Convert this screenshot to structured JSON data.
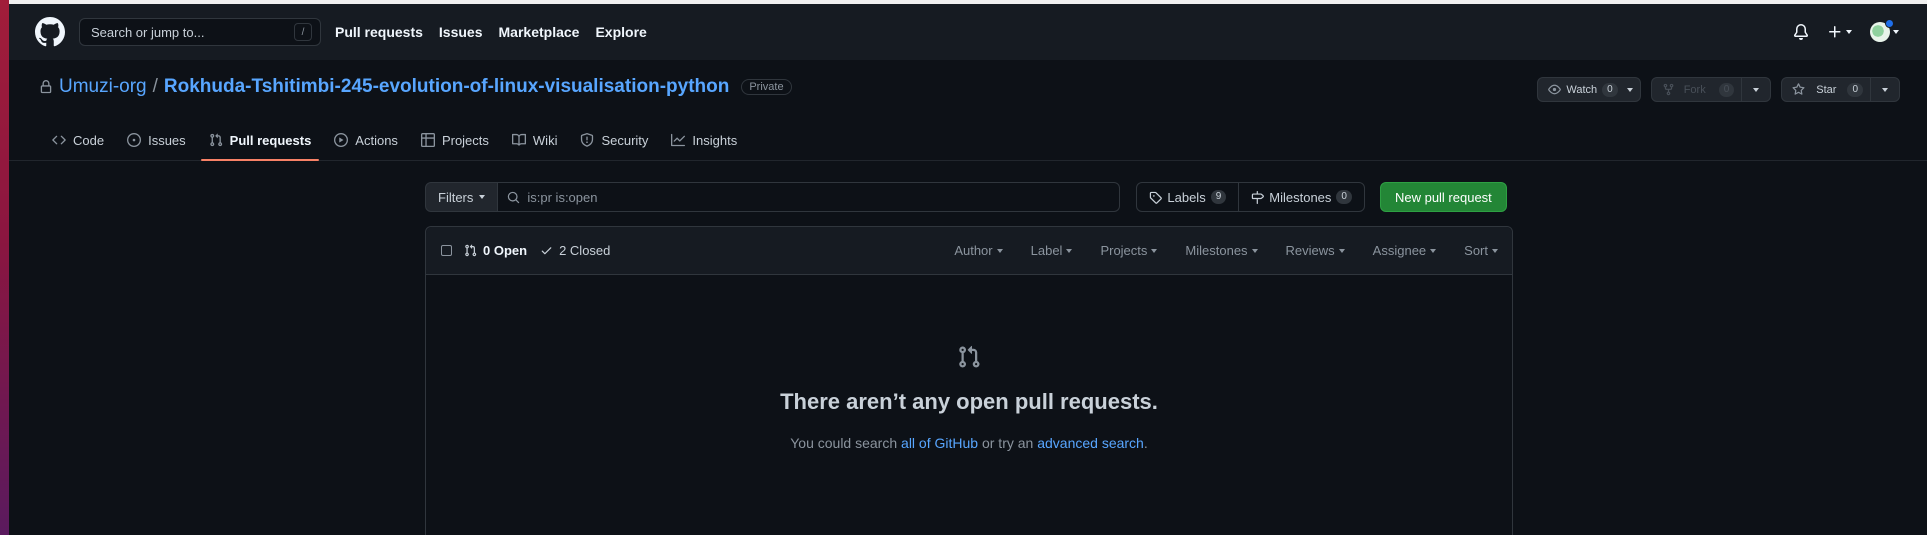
{
  "header": {
    "search_placeholder": "Search or jump to...",
    "search_key": "/",
    "nav": [
      "Pull requests",
      "Issues",
      "Marketplace",
      "Explore"
    ]
  },
  "repo": {
    "owner": "Umuzi-org",
    "separator": "/",
    "name": "Rokhuda-Tshitimbi-245-evolution-of-linux-visualisation-python",
    "visibility": "Private",
    "watch": {
      "label": "Watch",
      "count": "0"
    },
    "fork": {
      "label": "Fork",
      "count": "0"
    },
    "star": {
      "label": "Star",
      "count": "0"
    }
  },
  "tabs": [
    {
      "label": "Code",
      "icon": "code-icon"
    },
    {
      "label": "Issues",
      "icon": "issue-opened-icon"
    },
    {
      "label": "Pull requests",
      "icon": "git-pull-request-icon",
      "active": true
    },
    {
      "label": "Actions",
      "icon": "play-icon"
    },
    {
      "label": "Projects",
      "icon": "table-icon"
    },
    {
      "label": "Wiki",
      "icon": "book-icon"
    },
    {
      "label": "Security",
      "icon": "shield-icon"
    },
    {
      "label": "Insights",
      "icon": "graph-icon"
    }
  ],
  "subnav": {
    "filters_label": "Filters",
    "query": "is:pr is:open",
    "labels_label": "Labels",
    "labels_count": "9",
    "milestones_label": "Milestones",
    "milestones_count": "0",
    "new_pr_label": "New pull request"
  },
  "list": {
    "open_label": "0 Open",
    "closed_label": "2 Closed",
    "filters": [
      "Author",
      "Label",
      "Projects",
      "Milestones",
      "Reviews",
      "Assignee",
      "Sort"
    ]
  },
  "blankslate": {
    "title": "There aren’t any open pull requests.",
    "text_before": "You could search ",
    "link1": "all of GitHub",
    "text_middle": " or try an ",
    "link2": "advanced search",
    "text_after": "."
  },
  "colors": {
    "background": "#0d1117",
    "header": "#161b22",
    "accent_link": "#58a6ff",
    "primary_button": "#238636",
    "active_tab_underline": "#f78166",
    "notification_dot": "#1f6feb"
  }
}
